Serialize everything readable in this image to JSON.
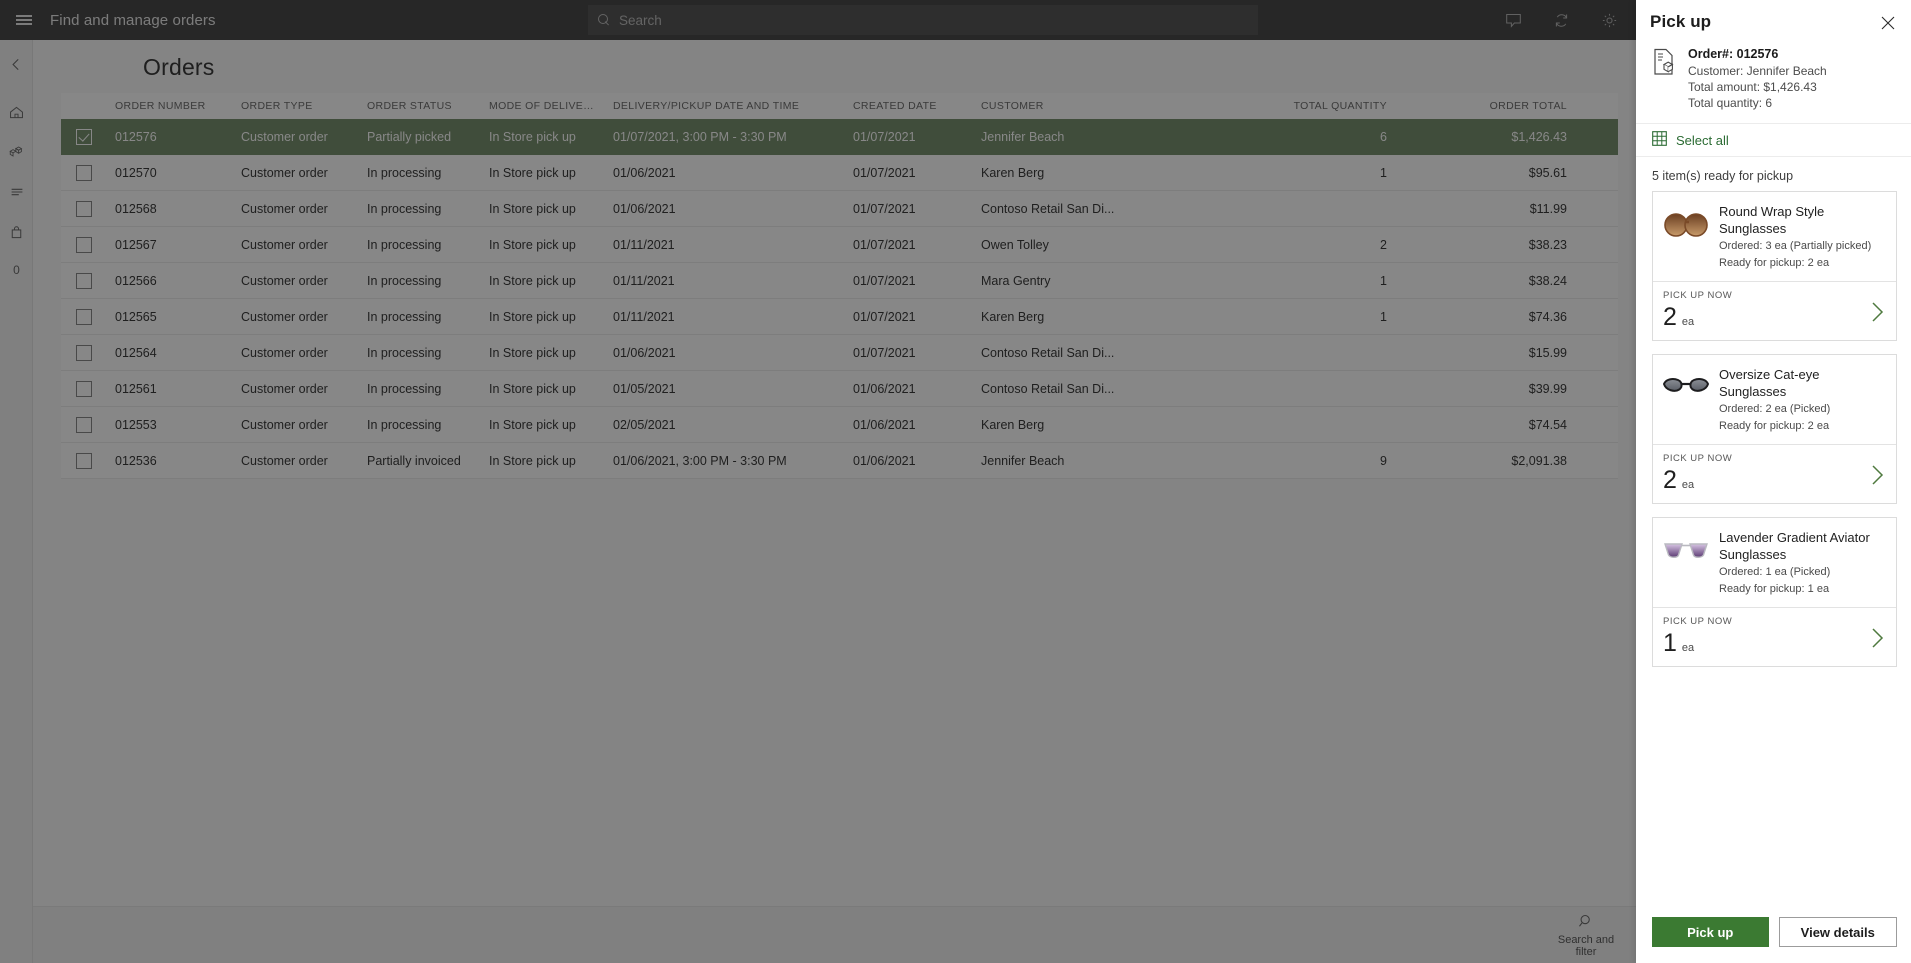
{
  "topbar": {
    "app_title": "Find and manage orders",
    "search_placeholder": "Search",
    "icons": [
      "note-icon",
      "refresh-icon",
      "gear-icon"
    ]
  },
  "leftrail": {
    "items": [
      {
        "name": "back-arrow-icon",
        "label": ""
      },
      {
        "name": "home-icon",
        "label": ""
      },
      {
        "name": "products-icon",
        "label": ""
      },
      {
        "name": "list-icon",
        "label": ""
      },
      {
        "name": "bag-icon",
        "label": ""
      },
      {
        "name": "cart-count",
        "label": "0"
      }
    ]
  },
  "page": {
    "title": "Orders"
  },
  "grid": {
    "columns": [
      "ORDER NUMBER",
      "ORDER TYPE",
      "ORDER STATUS",
      "MODE OF DELIVERY",
      "DELIVERY/PICKUP DATE AND TIME",
      "CREATED DATE",
      "CUSTOMER",
      "TOTAL QUANTITY",
      "ORDER TOTAL"
    ],
    "rows": [
      {
        "selected": true,
        "order_number": "012576",
        "order_type": "Customer order",
        "order_status": "Partially picked",
        "mode_of_delivery": "In Store pick up",
        "delivery_datetime": "01/07/2021, 3:00 PM - 3:30 PM",
        "created_date": "01/07/2021",
        "customer": "Jennifer Beach",
        "total_quantity": "6",
        "order_total": "$1,426.43"
      },
      {
        "selected": false,
        "order_number": "012570",
        "order_type": "Customer order",
        "order_status": "In processing",
        "mode_of_delivery": "In Store pick up",
        "delivery_datetime": "01/06/2021",
        "created_date": "01/07/2021",
        "customer": "Karen Berg",
        "total_quantity": "1",
        "order_total": "$95.61"
      },
      {
        "selected": false,
        "order_number": "012568",
        "order_type": "Customer order",
        "order_status": "In processing",
        "mode_of_delivery": "In Store pick up",
        "delivery_datetime": "01/06/2021",
        "created_date": "01/07/2021",
        "customer": "Contoso Retail San Di...",
        "total_quantity": "",
        "order_total": "$11.99"
      },
      {
        "selected": false,
        "order_number": "012567",
        "order_type": "Customer order",
        "order_status": "In processing",
        "mode_of_delivery": "In Store pick up",
        "delivery_datetime": "01/11/2021",
        "created_date": "01/07/2021",
        "customer": "Owen Tolley",
        "total_quantity": "2",
        "order_total": "$38.23"
      },
      {
        "selected": false,
        "order_number": "012566",
        "order_type": "Customer order",
        "order_status": "In processing",
        "mode_of_delivery": "In Store pick up",
        "delivery_datetime": "01/11/2021",
        "created_date": "01/07/2021",
        "customer": "Mara Gentry",
        "total_quantity": "1",
        "order_total": "$38.24"
      },
      {
        "selected": false,
        "order_number": "012565",
        "order_type": "Customer order",
        "order_status": "In processing",
        "mode_of_delivery": "In Store pick up",
        "delivery_datetime": "01/11/2021",
        "created_date": "01/07/2021",
        "customer": "Karen Berg",
        "total_quantity": "1",
        "order_total": "$74.36"
      },
      {
        "selected": false,
        "order_number": "012564",
        "order_type": "Customer order",
        "order_status": "In processing",
        "mode_of_delivery": "In Store pick up",
        "delivery_datetime": "01/06/2021",
        "created_date": "01/07/2021",
        "customer": "Contoso Retail San Di...",
        "total_quantity": "",
        "order_total": "$15.99"
      },
      {
        "selected": false,
        "order_number": "012561",
        "order_type": "Customer order",
        "order_status": "In processing",
        "mode_of_delivery": "In Store pick up",
        "delivery_datetime": "01/05/2021",
        "created_date": "01/06/2021",
        "customer": "Contoso Retail San Di...",
        "total_quantity": "",
        "order_total": "$39.99"
      },
      {
        "selected": false,
        "order_number": "012553",
        "order_type": "Customer order",
        "order_status": "In processing",
        "mode_of_delivery": "In Store pick up",
        "delivery_datetime": "02/05/2021",
        "created_date": "01/06/2021",
        "customer": "Karen Berg",
        "total_quantity": "",
        "order_total": "$74.54"
      },
      {
        "selected": false,
        "order_number": "012536",
        "order_type": "Customer order",
        "order_status": "Partially invoiced",
        "mode_of_delivery": "In Store pick up",
        "delivery_datetime": "01/06/2021, 3:00 PM - 3:30 PM",
        "created_date": "01/06/2021",
        "customer": "Jennifer Beach",
        "total_quantity": "9",
        "order_total": "$2,091.38"
      }
    ]
  },
  "bottombar": {
    "actions": [
      {
        "icon": "search-icon",
        "label": "Search and filter"
      }
    ]
  },
  "pickup_panel": {
    "title": "Pick up",
    "close_icon": "close-icon",
    "order": {
      "doc_icon": "order-document-icon",
      "order_number_label": "Order#: 012576",
      "customer_label": "Customer: Jennifer Beach",
      "total_amount_label": "Total amount: $1,426.43",
      "total_quantity_label": "Total quantity: 6"
    },
    "select_all": {
      "icon": "select-all-grid-icon",
      "label": "Select all"
    },
    "ready_count_label": "5 item(s) ready for pickup",
    "items": [
      {
        "thumb": "round-wrap-sunglasses-thumb",
        "name": "Round Wrap Style Sunglasses",
        "ordered_label": "Ordered: 3 ea (Partially picked)",
        "ready_label": "Ready for pickup: 2 ea",
        "pick_up_now_label": "PICK UP NOW",
        "qty": "2",
        "uom": "ea",
        "chevron": "chevron-right-icon"
      },
      {
        "thumb": "cat-eye-sunglasses-thumb",
        "name": "Oversize Cat-eye Sunglasses",
        "ordered_label": "Ordered: 2 ea (Picked)",
        "ready_label": "Ready for pickup: 2 ea",
        "pick_up_now_label": "PICK UP NOW",
        "qty": "2",
        "uom": "ea",
        "chevron": "chevron-right-icon"
      },
      {
        "thumb": "aviator-sunglasses-thumb",
        "name": "Lavender Gradient Aviator Sunglasses",
        "ordered_label": "Ordered: 1 ea (Picked)",
        "ready_label": "Ready for pickup: 1 ea",
        "pick_up_now_label": "PICK UP NOW",
        "qty": "1",
        "uom": "ea",
        "chevron": "chevron-right-icon"
      }
    ],
    "footer": {
      "primary_label": "Pick up",
      "secondary_label": "View details"
    }
  },
  "colors": {
    "selected_row_green": "#7a9270",
    "accent_green": "#3b7a32",
    "link_green": "#2b6b33",
    "topbar_gray": "#4a4a4a"
  }
}
